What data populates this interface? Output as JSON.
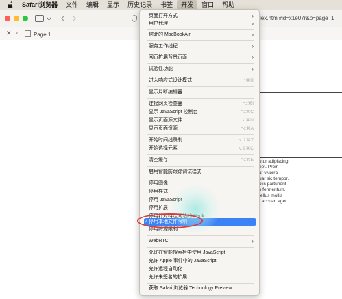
{
  "menubar": {
    "apple_icon": "apple-logo-icon",
    "items": [
      "Safari浏览器",
      "文件",
      "编辑",
      "显示",
      "历史记录",
      "书签",
      "开发",
      "窗口",
      "帮助"
    ],
    "active_item": "开发"
  },
  "toolbar": {
    "address_text": "lex.html#id=x1e07r&p=page_1",
    "icons": [
      "sidebar-icon",
      "chevron-down-icon",
      "back-icon",
      "forward-icon",
      "shield-icon"
    ]
  },
  "tab": {
    "title": "Page 1",
    "close_glyph": "✕",
    "chevron_glyph": "›"
  },
  "page": {
    "lorem_lines": [
      "etur adipiscing",
      "eet. Proin",
      "at viverra",
      "uar sic tempor.",
      "olis parturient",
      "s fermentum,",
      "tellus mollis",
      "r accuan eget."
    ]
  },
  "dev_menu": {
    "items": [
      {
        "label": "页面打开方式",
        "arrow": "›"
      },
      {
        "label": "用户代理",
        "arrow": "›"
      },
      {
        "label": "何北的 MacBookAir",
        "arrow": "›"
      },
      {
        "label": "服务工作线程",
        "arrow": "›"
      },
      {
        "label": "网页扩展背景页面",
        "arrow": "›"
      },
      {
        "label": "试验性功能",
        "arrow": "›"
      },
      {
        "label": "进入响应式设计模式",
        "shortcut": "^⌘R"
      },
      {
        "label": "显示片断编辑器"
      },
      {
        "label": "连接网页检查器",
        "shortcut": "⌥⌘I"
      },
      {
        "label": "显示 JavaScript 控制台",
        "shortcut": "⌥⌘C"
      },
      {
        "label": "显示页面源文件",
        "shortcut": "⌥⌘U"
      },
      {
        "label": "显示页面资源",
        "shortcut": "⌥⌘A"
      },
      {
        "label": "开始时间线录制",
        "shortcut": "⌥⇧⌘T"
      },
      {
        "label": "开始选择元素",
        "shortcut": "⌥⇧⌘C"
      },
      {
        "label": "清空缓存",
        "shortcut": "⌥⌘E"
      },
      {
        "label": "启用智能防跟踪调试模式"
      },
      {
        "label": "停用图像"
      },
      {
        "label": "停用样式"
      },
      {
        "label": "停用 JavaScript"
      },
      {
        "label": "停用扩展"
      },
      {
        "label": "停用针对特定网站的 Hack"
      },
      {
        "label": "停用本地文件限制",
        "checked": "✓"
      },
      {
        "label": "停用跨源限制"
      },
      {
        "label": "WebRTC",
        "arrow": "›"
      },
      {
        "label": "允许在智能搜索栏中使用 JavaScript"
      },
      {
        "label": "允许 Apple 事件中的 JavaScript"
      },
      {
        "label": "允许远程自动化"
      },
      {
        "label": "允许未签名的扩展"
      },
      {
        "label": "获取 Safari 浏览器 Technology Preview"
      }
    ]
  }
}
